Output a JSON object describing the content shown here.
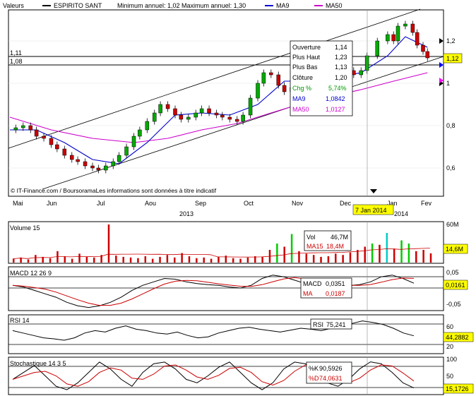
{
  "header": {
    "values_label": "Valeurs",
    "stock_name": "ESPIRITO SANT",
    "min_max": "Minimum annuel: 1,02 Maximum annuel: 1,30",
    "ma9_label": "MA9",
    "ma50_label": "MA50"
  },
  "colors": {
    "candle_up": "#00aa00",
    "candle_down": "#cc0000",
    "ma9": "#0000cc",
    "ma50": "#cc00cc",
    "channel": "#000000",
    "volume_bar": "#cc0000",
    "volume_hi": "#00cc00",
    "volume_alt": "#00cccc",
    "price_tag": "#ffff00",
    "ma9_tag": "#0000ff",
    "ma50_tag": "#ff00ff"
  },
  "price_panel": {
    "left_levels": [
      "1,11",
      "1,08"
    ],
    "right_ticks": [
      "1,2",
      "1",
      "0,8",
      "0,6"
    ],
    "current_price_tag": "1,12",
    "credit": "© IT-Finance.com / BoursoramaLes informations sont données à titre indicatif",
    "tooltip": {
      "rows": [
        {
          "label": "Ouverture",
          "value": "1,14"
        },
        {
          "label": "Plus Haut",
          "value": "1,23"
        },
        {
          "label": "Plus Bas",
          "value": "1,13"
        },
        {
          "label": "Clôture",
          "value": "1,20"
        },
        {
          "label": "Chg %",
          "value": "5,74%"
        },
        {
          "label": "MA9",
          "value": "1,0842"
        },
        {
          "label": "MA50",
          "value": "1,0127"
        }
      ]
    }
  },
  "x_axis": {
    "months": [
      "Mai",
      "Jun",
      "Jul",
      "Aou",
      "Sep",
      "Oct",
      "Nov",
      "Dec",
      "Jan",
      "Fev"
    ],
    "years": [
      "2013",
      "2014"
    ],
    "cursor_date": "7 Jan 2014"
  },
  "volume_panel": {
    "title": "Volume 15",
    "right_ticks": [
      "60M"
    ],
    "tag": "14,6M",
    "box": [
      {
        "label": "Vol",
        "value": "46,7M"
      },
      {
        "label": "MA15",
        "value": "18,4M"
      }
    ]
  },
  "macd_panel": {
    "title": "MACD 12 26 9",
    "right_ticks": [
      "0,05",
      "-0,05"
    ],
    "tag": "0,0161",
    "box": [
      {
        "label": "MACD",
        "value": "0,0351"
      },
      {
        "label": "MA",
        "value": "0,0187"
      }
    ]
  },
  "rsi_panel": {
    "title": "RSI 14",
    "right_ticks": [
      "60",
      "20"
    ],
    "tag": "44,2882",
    "box": [
      {
        "label": "RSI",
        "value": "75,241"
      }
    ]
  },
  "stoch_panel": {
    "title": "Stochastique 14 3 5",
    "right_ticks": [
      "100",
      "50"
    ],
    "tag": "15,1726",
    "box": [
      {
        "label": "%K",
        "value": "90,5926"
      },
      {
        "label": "%D",
        "value": "74,0631"
      }
    ]
  },
  "chart_data": {
    "type": "candlestick",
    "title": "ESPIRITO SANT",
    "x_range": [
      "2013-04-22",
      "2014-02-07"
    ],
    "ylim": [
      0.53,
      1.37
    ],
    "selected": {
      "date": "2014-01-07",
      "open": 1.14,
      "high": 1.23,
      "low": 1.13,
      "close": 1.2,
      "change_pct": 5.74,
      "ma9": 1.0842,
      "ma50": 1.0127
    },
    "close_series": [
      [
        "2013-04-22",
        0.78
      ],
      [
        "2013-04-26",
        0.79
      ],
      [
        "2013-05-01",
        0.8
      ],
      [
        "2013-05-06",
        0.78
      ],
      [
        "2013-05-10",
        0.75
      ],
      [
        "2013-05-15",
        0.74
      ],
      [
        "2013-05-20",
        0.71
      ],
      [
        "2013-05-24",
        0.69
      ],
      [
        "2013-05-29",
        0.66
      ],
      [
        "2013-06-03",
        0.64
      ],
      [
        "2013-06-07",
        0.63
      ],
      [
        "2013-06-12",
        0.61
      ],
      [
        "2013-06-17",
        0.6
      ],
      [
        "2013-06-21",
        0.59
      ],
      [
        "2013-06-26",
        0.61
      ],
      [
        "2013-07-01",
        0.63
      ],
      [
        "2013-07-05",
        0.66
      ],
      [
        "2013-07-10",
        0.7
      ],
      [
        "2013-07-15",
        0.75
      ],
      [
        "2013-07-19",
        0.78
      ],
      [
        "2013-07-24",
        0.82
      ],
      [
        "2013-07-29",
        0.86
      ],
      [
        "2013-08-02",
        0.9
      ],
      [
        "2013-08-07",
        0.88
      ],
      [
        "2013-08-12",
        0.85
      ],
      [
        "2013-08-16",
        0.83
      ],
      [
        "2013-08-21",
        0.84
      ],
      [
        "2013-08-26",
        0.86
      ],
      [
        "2013-08-30",
        0.88
      ],
      [
        "2013-09-04",
        0.86
      ],
      [
        "2013-09-09",
        0.85
      ],
      [
        "2013-09-13",
        0.84
      ],
      [
        "2013-09-18",
        0.83
      ],
      [
        "2013-09-23",
        0.82
      ],
      [
        "2013-09-27",
        0.85
      ],
      [
        "2013-10-02",
        0.93
      ],
      [
        "2013-10-07",
        1.0
      ],
      [
        "2013-10-11",
        1.05
      ],
      [
        "2013-10-16",
        1.04
      ],
      [
        "2013-10-21",
        0.99
      ],
      [
        "2013-10-25",
        0.96
      ],
      [
        "2013-10-30",
        0.98
      ],
      [
        "2013-11-04",
        1.0
      ],
      [
        "2013-11-08",
        1.03
      ],
      [
        "2013-11-13",
        1.05
      ],
      [
        "2013-12-06",
        1.06
      ],
      [
        "2013-12-11",
        1.04
      ],
      [
        "2013-12-16",
        1.06
      ],
      [
        "2013-12-20",
        1.13
      ],
      [
        "2013-12-27",
        1.2
      ],
      [
        "2014-01-03",
        1.23
      ],
      [
        "2014-01-07",
        1.2
      ],
      [
        "2014-01-10",
        1.27
      ],
      [
        "2014-01-15",
        1.28
      ],
      [
        "2014-01-20",
        1.24
      ],
      [
        "2014-01-23",
        1.18
      ],
      [
        "2014-01-27",
        1.15
      ],
      [
        "2014-01-30",
        1.12
      ]
    ],
    "ma9_series": [
      [
        "2013-04-22",
        0.78
      ],
      [
        "2013-05-10",
        0.78
      ],
      [
        "2013-05-29",
        0.72
      ],
      [
        "2013-06-17",
        0.64
      ],
      [
        "2013-07-05",
        0.62
      ],
      [
        "2013-07-24",
        0.72
      ],
      [
        "2013-08-12",
        0.85
      ],
      [
        "2013-08-30",
        0.86
      ],
      [
        "2013-09-18",
        0.85
      ],
      [
        "2013-10-07",
        0.9
      ],
      [
        "2013-10-25",
        1.01
      ],
      [
        "2013-11-13",
        1.01
      ],
      [
        "2013-12-16",
        1.05
      ],
      [
        "2014-01-03",
        1.13
      ],
      [
        "2014-01-15",
        1.22
      ],
      [
        "2014-01-30",
        1.17
      ]
    ],
    "ma50_series": [
      [
        "2013-04-22",
        0.84
      ],
      [
        "2013-05-20",
        0.78
      ],
      [
        "2013-06-17",
        0.74
      ],
      [
        "2013-07-15",
        0.72
      ],
      [
        "2013-08-07",
        0.74
      ],
      [
        "2013-08-30",
        0.78
      ],
      [
        "2013-09-23",
        0.81
      ],
      [
        "2013-10-16",
        0.86
      ],
      [
        "2013-11-13",
        0.92
      ],
      [
        "2013-12-16",
        0.97
      ],
      [
        "2014-01-07",
        1.01
      ],
      [
        "2014-01-30",
        1.05
      ]
    ],
    "volume_millions": [
      6,
      8,
      5,
      12,
      9,
      7,
      18,
      10,
      6,
      14,
      9,
      8,
      12,
      60,
      11,
      9,
      8,
      7,
      10,
      6,
      9,
      12,
      8,
      15,
      10,
      7,
      8,
      6,
      9,
      11,
      7,
      6,
      8,
      10,
      9,
      20,
      30,
      25,
      45,
      18,
      14,
      12,
      9,
      10,
      14,
      12,
      16,
      20,
      25,
      30,
      28,
      46.7,
      22,
      35,
      30,
      18,
      20,
      14.6
    ],
    "macd": [
      0.01,
      0.005,
      -0.005,
      -0.015,
      -0.025,
      -0.04,
      -0.05,
      -0.055,
      -0.05,
      -0.04,
      -0.025,
      -0.005,
      0.01,
      0.02,
      0.03,
      0.028,
      0.02,
      0.015,
      0.012,
      0.01,
      0.005,
      0.002,
      0.01,
      0.03,
      0.04,
      0.035,
      0.025,
      0.015,
      0.012,
      0.01,
      0.008,
      0.009,
      0.012,
      0.02,
      0.035,
      0.04,
      0.03,
      0.0161
    ],
    "rsi": [
      55,
      50,
      45,
      40,
      38,
      35,
      40,
      50,
      55,
      52,
      60,
      65,
      58,
      55,
      50,
      48,
      52,
      45,
      40,
      42,
      50,
      55,
      60,
      62,
      58,
      55,
      52,
      56,
      60,
      58,
      55,
      60,
      65,
      70,
      75.241,
      72,
      68,
      60,
      50,
      44.2882
    ],
    "stoch_k": [
      40,
      60,
      80,
      50,
      20,
      10,
      30,
      60,
      90,
      70,
      40,
      20,
      60,
      85,
      90,
      70,
      40,
      30,
      50,
      75,
      90,
      60,
      30,
      10,
      30,
      70,
      90,
      85,
      60,
      30,
      20,
      40,
      70,
      90.5926,
      85,
      60,
      30,
      15.1726
    ]
  }
}
